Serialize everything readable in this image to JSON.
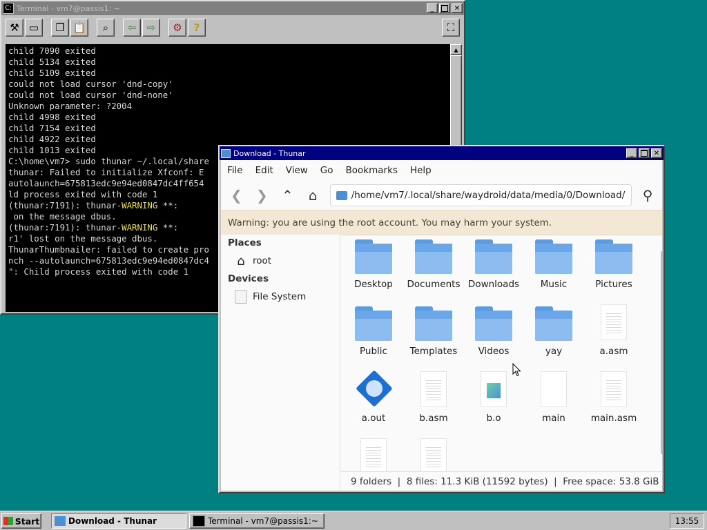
{
  "terminal": {
    "title": "Terminal - vm7@passis1: ~",
    "lines": [
      "child 7090 exited",
      "child 5134 exited",
      "child 5109 exited",
      "could not load cursor 'dnd-copy'",
      "could not load cursor 'dnd-none'",
      "Unknown parameter: ?2004",
      "child 4998 exited",
      "child 7154 exited",
      "child 4922 exited",
      "child 1013 exited",
      "C:\\home\\vm7> sudo thunar ~/.local/share",
      "thunar: Failed to initialize Xfconf: E",
      "autolaunch=675813edc9e94ed0847dc4ff654",
      "ld process exited with code 1",
      "",
      "",
      "(thunar:7191): thunar-WARNING **:",
      " on the message dbus.",
      "",
      "(thunar:7191): thunar-WARNING **:",
      "r1' lost on the message dbus.",
      "ThunarThumbnailer: failed to create pro",
      "nch --autolaunch=675813edc9e94ed0847dc4",
      "\": Child process exited with code 1"
    ]
  },
  "thunar": {
    "title": "Download - Thunar",
    "menu": [
      "File",
      "Edit",
      "View",
      "Go",
      "Bookmarks",
      "Help"
    ],
    "path": "/home/vm7/.local/share/waydroid/data/media/0/Download/",
    "warning": "Warning: you are using the root account. You may harm your system.",
    "places_header": "Places",
    "places": [
      {
        "label": "root",
        "icon": "home-icon"
      }
    ],
    "devices_header": "Devices",
    "devices": [
      {
        "label": "File System",
        "icon": "drive-icon"
      }
    ],
    "items": [
      {
        "label": "Desktop",
        "type": "folder"
      },
      {
        "label": "Documents",
        "type": "folder"
      },
      {
        "label": "Downloads",
        "type": "folder"
      },
      {
        "label": "Music",
        "type": "folder"
      },
      {
        "label": "Pictures",
        "type": "folder"
      },
      {
        "label": "Public",
        "type": "folder"
      },
      {
        "label": "Templates",
        "type": "folder"
      },
      {
        "label": "Videos",
        "type": "folder"
      },
      {
        "label": "yay",
        "type": "folder"
      },
      {
        "label": "a.asm",
        "type": "text"
      },
      {
        "label": "a.out",
        "type": "exec"
      },
      {
        "label": "b.asm",
        "type": "text"
      },
      {
        "label": "b.o",
        "type": "object"
      },
      {
        "label": "main",
        "type": "blank"
      },
      {
        "label": "main.asm",
        "type": "text"
      },
      {
        "label": "",
        "type": "text"
      },
      {
        "label": "",
        "type": "text"
      }
    ],
    "status": "9 folders  |  8 files: 11.3 KiB (11592 bytes)  |  Free space: 53.8 GiB"
  },
  "taskbar": {
    "start_label": "Start",
    "tasks": [
      {
        "label": "Download - Thunar",
        "active": true
      },
      {
        "label": "Terminal - vm7@passis1:~",
        "active": false
      }
    ],
    "clock": "13:55"
  },
  "colors": {
    "desktop": "#008080",
    "title_active": "#000080",
    "title_inactive": "#808080",
    "folder": "#8cbcf0",
    "warning_bg": "#f3e7d6",
    "terminal_warning": "#f0e030"
  }
}
